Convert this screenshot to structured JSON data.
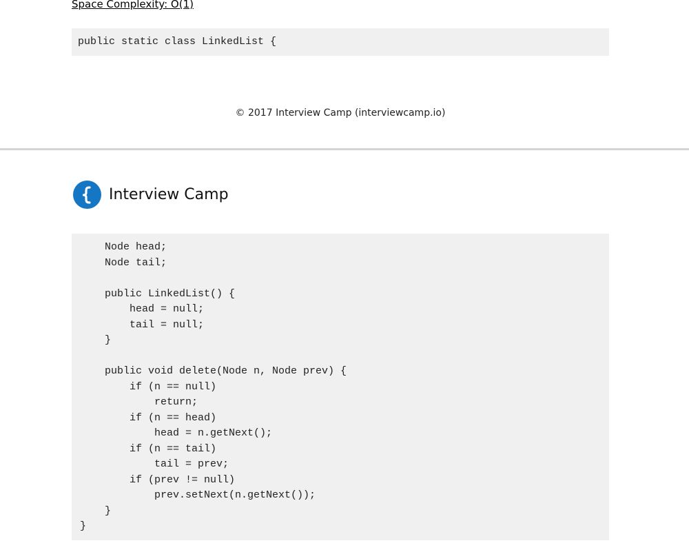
{
  "complexity": {
    "space": "Space Complexity: O(1)"
  },
  "code_top": {
    "text": "public static class LinkedList {"
  },
  "footer": {
    "copyright": "© 2017 Interview Camp (interviewcamp.io)"
  },
  "brand": {
    "name": "Interview Camp",
    "logo_icon": "curly-brace-logo-icon",
    "logo_color": "#1577c3"
  },
  "code_main": {
    "text": "    Node head;\n    Node tail;\n\n    public LinkedList() {\n        head = null;\n        tail = null;\n    }\n\n    public void delete(Node n, Node prev) {\n        if (n == null)\n            return;\n        if (n == head)\n            head = n.getNext();\n        if (n == tail)\n            tail = prev;\n        if (prev != null)\n            prev.setNext(n.getNext());\n    }\n}"
  }
}
